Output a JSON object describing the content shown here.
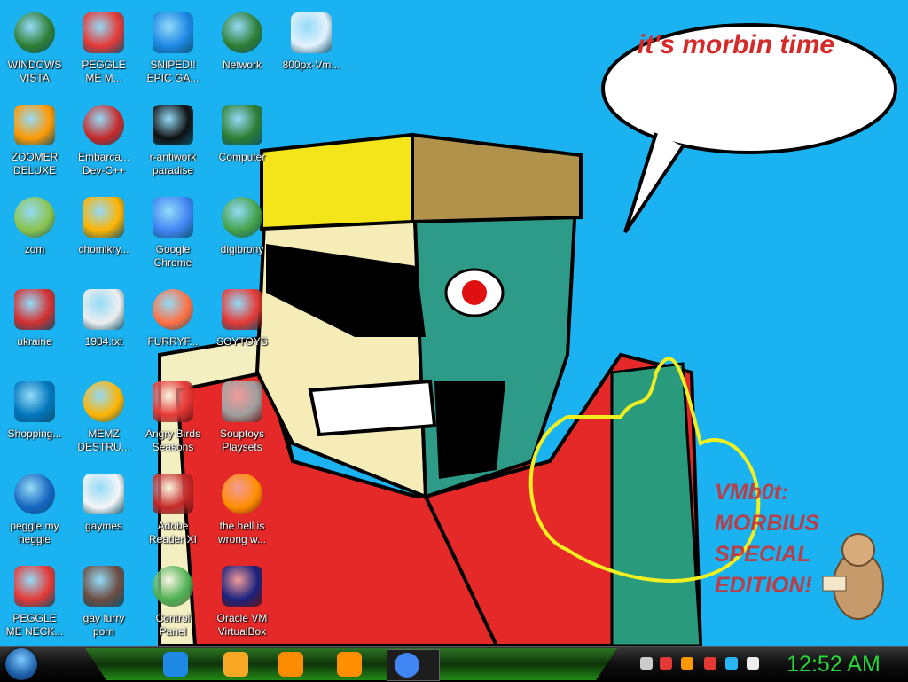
{
  "desktop": {
    "speech_text": "it's morbin time",
    "wallpaper_caption": [
      "VMb0t:",
      "MORBIUS",
      "SPECIAL",
      "EDITION!"
    ],
    "icons": [
      {
        "name": "windows-vista-icon",
        "label": [
          "WINDOWS",
          "VISTA"
        ]
      },
      {
        "name": "peggle-me-icon",
        "label": [
          "PEGGLE",
          "ME M..."
        ]
      },
      {
        "name": "sniped-skype-icon",
        "label": [
          "SNIPED!!",
          "EPIC GA..."
        ]
      },
      {
        "name": "network-icon",
        "label": [
          "Network",
          ""
        ]
      },
      {
        "name": "vmbot-image-icon",
        "label": [
          "800px-Vm...",
          ""
        ]
      },
      {
        "name": "zoomer-deluxe-icon",
        "label": [
          "ZOOMER",
          "DELUXE"
        ]
      },
      {
        "name": "dev-cpp-icon",
        "label": [
          "Embarca...",
          "Dev-C++"
        ]
      },
      {
        "name": "r-antiwork-icon",
        "label": [
          "r-antiwork",
          "paradise"
        ]
      },
      {
        "name": "computer-icon",
        "label": [
          "Computer",
          ""
        ]
      },
      {
        "name": "zom-icon",
        "label": [
          "zom",
          ""
        ]
      },
      {
        "name": "chomikry-shortcut-icon",
        "label": [
          "chomikry...",
          ""
        ]
      },
      {
        "name": "google-chrome-icon",
        "label": [
          "Google",
          "Chrome"
        ]
      },
      {
        "name": "digibrony-icon",
        "label": [
          "digibrony",
          ""
        ]
      },
      {
        "name": "ukraine-radiation-icon",
        "label": [
          "ukraine",
          ""
        ]
      },
      {
        "name": "text-file-icon",
        "label": [
          "1984.txt",
          ""
        ]
      },
      {
        "name": "firefox-icon",
        "label": [
          "FURRYF...",
          ""
        ]
      },
      {
        "name": "soytoys-icon",
        "label": [
          "SOYTOYS",
          ""
        ]
      },
      {
        "name": "flash-shopping-icon",
        "label": [
          "Shopping...",
          ""
        ]
      },
      {
        "name": "memz-shortcut-icon",
        "label": [
          "MEMZ",
          "DESTRU..."
        ]
      },
      {
        "name": "angry-birds-icon",
        "label": [
          "Angry Birds",
          "Seasons"
        ]
      },
      {
        "name": "souptoys-icon",
        "label": [
          "Souptoys",
          "Playsets"
        ]
      },
      {
        "name": "peggle-heggle-icon",
        "label": [
          "peggle my",
          "heggle"
        ]
      },
      {
        "name": "gaymes-folder-icon",
        "label": [
          "gaymes",
          ""
        ]
      },
      {
        "name": "adobe-reader-icon",
        "label": [
          "Adobe",
          "Reader XI"
        ]
      },
      {
        "name": "uc-browser-icon",
        "label": [
          "the hell is",
          "wrong w..."
        ]
      },
      {
        "name": "peggle-neck-icon",
        "label": [
          "PEGGLE",
          "ME NECK..."
        ]
      },
      {
        "name": "box-hamster-icon",
        "label": [
          "gay furry",
          "porn"
        ]
      },
      {
        "name": "control-panel-icon",
        "label": [
          "Control",
          "Panel"
        ]
      },
      {
        "name": "virtualbox-icon",
        "label": [
          "Oracle VM",
          "VirtualBox"
        ]
      }
    ]
  },
  "taskbar": {
    "pinned": [
      "internet-explorer-icon",
      "file-explorer-icon",
      "media-player-icon",
      "uc-browser-icon",
      "google-chrome-icon"
    ],
    "tray": [
      "network-tray-icon",
      "antivirus-tray-icon",
      "search-tray-icon",
      "flag-tray-icon",
      "monitor-tray-icon",
      "media-tray-icon"
    ],
    "clock": "12:52 AM"
  },
  "colors": {
    "sky": "#1ab2f0",
    "clock": "#27d637",
    "caption": "#d42a2a"
  }
}
